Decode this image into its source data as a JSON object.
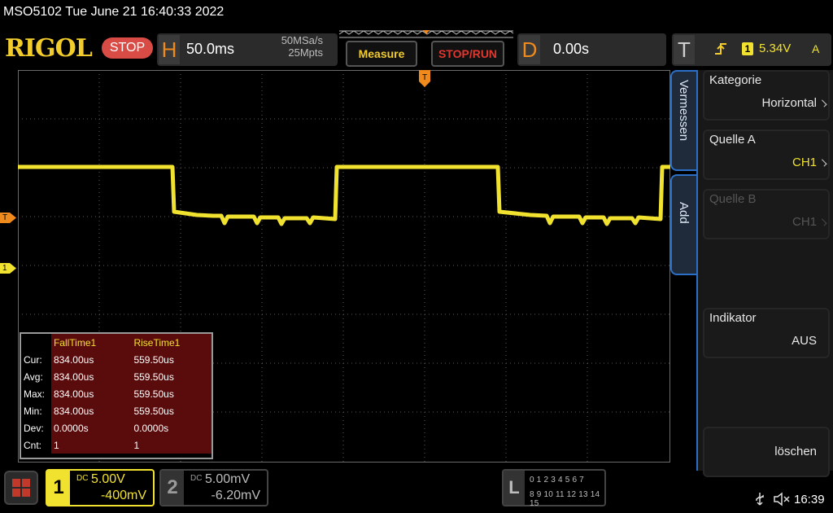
{
  "title": {
    "model_date": "MSO5102  Tue June 21 16:40:33 2022"
  },
  "header": {
    "logo": "RIGOL",
    "run_state": "STOP",
    "horizontal": {
      "letter": "H",
      "timebase": "50.0ms",
      "sample_rate": "50MSa/s",
      "memory_depth": "25Mpts"
    },
    "measure_button": "Measure",
    "stoprun_button": "STOP/RUN",
    "delay": {
      "letter": "D",
      "value": "0.00s"
    },
    "trigger": {
      "letter": "T",
      "edge_icon": "rising-edge-icon",
      "source": "1",
      "level": "5.34V",
      "mode": "A"
    }
  },
  "markers": {
    "trigger_level": "T",
    "channel1": "1"
  },
  "measurements": {
    "headers": [
      "",
      "FallTime1",
      "RiseTime1"
    ],
    "rows": [
      {
        "label": "Cur:",
        "fall": "834.00us",
        "rise": "559.50us"
      },
      {
        "label": "Avg:",
        "fall": "834.00us",
        "rise": "559.50us"
      },
      {
        "label": "Max:",
        "fall": "834.00us",
        "rise": "559.50us"
      },
      {
        "label": "Min:",
        "fall": "834.00us",
        "rise": "559.50us"
      },
      {
        "label": "Dev:",
        "fall": "0.0000s",
        "rise": "0.0000s"
      },
      {
        "label": "Cnt:",
        "fall": "1",
        "rise": "1"
      }
    ]
  },
  "side_tabs": {
    "measure": "Vermessen",
    "add": "Add"
  },
  "menu": {
    "category": {
      "label": "Kategorie",
      "value": "Horizontal"
    },
    "source_a": {
      "label": "Quelle A",
      "value": "CH1"
    },
    "source_b": {
      "label": "Quelle B",
      "value": "CH1"
    },
    "indicator": {
      "label": "Indikator",
      "value": "AUS"
    },
    "clear": {
      "label": "löschen"
    }
  },
  "bottom": {
    "ch1": {
      "num": "1",
      "coupling": "DC",
      "scale": "5.00V",
      "offset": "-400mV"
    },
    "ch2": {
      "num": "2",
      "coupling": "DC",
      "scale": "5.00mV",
      "offset": "-6.20mV"
    },
    "la": {
      "letter": "L",
      "row1": "0 1 2 3  4 5 6 7",
      "row2": "8 9 10 11 12 13 14 15"
    },
    "status": {
      "usb_icon": "usb-icon",
      "sound_icon": "speaker-muted-icon",
      "time": "16:39"
    }
  },
  "colors": {
    "ch1": "#f2e230",
    "trigger": "#f08a1c",
    "accent_blue": "#2b6fc7",
    "stop": "#d94b45"
  }
}
